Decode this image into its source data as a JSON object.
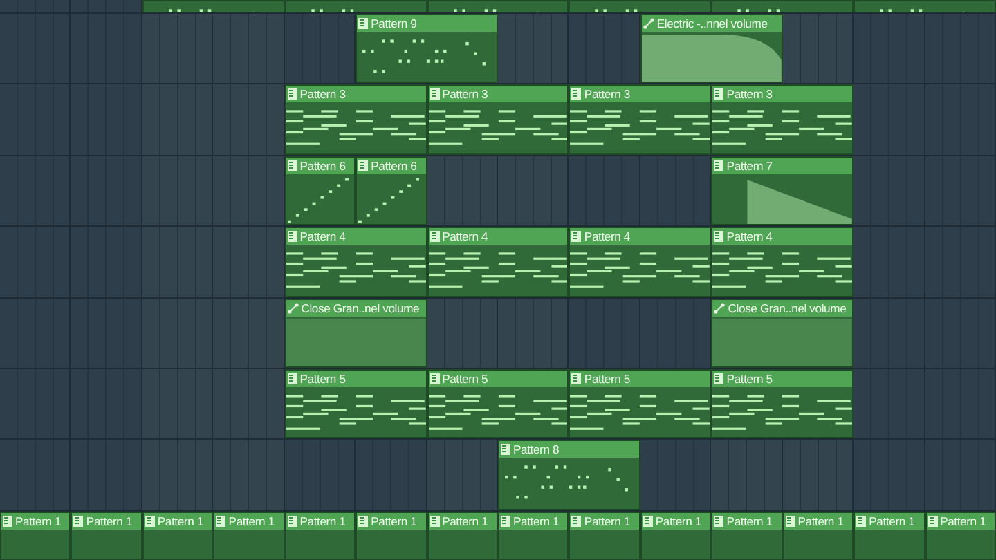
{
  "playlist": {
    "tracks": [
      {
        "items": [
          {
            "kind": "gap"
          },
          {
            "kind": "gap"
          },
          {
            "kind": "drums"
          },
          {
            "kind": "drums"
          },
          {
            "kind": "drums"
          },
          {
            "kind": "drums"
          },
          {
            "kind": "drums"
          },
          {
            "kind": "drums"
          }
        ]
      },
      {
        "items": [
          {
            "kind": "gap"
          },
          {
            "kind": "gap"
          },
          {
            "kind": "gap"
          },
          {
            "kind": "gap"
          },
          {
            "kind": "gap"
          },
          {
            "kind": "drums",
            "label": "Pattern 9"
          },
          {
            "kind": "gap"
          },
          {
            "kind": "gap"
          },
          {
            "kind": "automation-fall",
            "label": "Electric -..nnel volume"
          }
        ]
      },
      {
        "items": [
          {
            "kind": "gap"
          },
          {
            "kind": "gap"
          },
          {
            "kind": "gap"
          },
          {
            "kind": "gap"
          },
          {
            "kind": "notes",
            "label": "Pattern 3"
          },
          {
            "kind": "notes",
            "label": "Pattern 3"
          },
          {
            "kind": "notes",
            "label": "Pattern 3"
          },
          {
            "kind": "notes",
            "label": "Pattern 3"
          }
        ]
      },
      {
        "items": [
          {
            "kind": "gap"
          },
          {
            "kind": "gap"
          },
          {
            "kind": "gap"
          },
          {
            "kind": "gap"
          },
          {
            "kind": "ramp",
            "label": "Pattern 6"
          },
          {
            "kind": "ramp",
            "label": "Pattern 6"
          },
          {
            "kind": "gap"
          },
          {
            "kind": "gap"
          },
          {
            "kind": "gap"
          },
          {
            "kind": "gap"
          },
          {
            "kind": "slope",
            "label": "Pattern 7"
          }
        ]
      },
      {
        "items": [
          {
            "kind": "gap"
          },
          {
            "kind": "gap"
          },
          {
            "kind": "gap"
          },
          {
            "kind": "gap"
          },
          {
            "kind": "notes",
            "label": "Pattern 4"
          },
          {
            "kind": "notes",
            "label": "Pattern 4"
          },
          {
            "kind": "notes",
            "label": "Pattern 4"
          },
          {
            "kind": "notes",
            "label": "Pattern 4"
          }
        ]
      },
      {
        "items": [
          {
            "kind": "gap"
          },
          {
            "kind": "gap"
          },
          {
            "kind": "gap"
          },
          {
            "kind": "gap"
          },
          {
            "kind": "automation-flat",
            "label": "Close Gran..nel volume"
          },
          {
            "kind": "gap"
          },
          {
            "kind": "gap"
          },
          {
            "kind": "gap"
          },
          {
            "kind": "gap"
          },
          {
            "kind": "automation-flat",
            "label": "Close Gran..nel volume"
          }
        ]
      },
      {
        "items": [
          {
            "kind": "gap"
          },
          {
            "kind": "gap"
          },
          {
            "kind": "gap"
          },
          {
            "kind": "gap"
          },
          {
            "kind": "notes",
            "label": "Pattern 5"
          },
          {
            "kind": "notes",
            "label": "Pattern 5"
          },
          {
            "kind": "notes",
            "label": "Pattern 5"
          },
          {
            "kind": "notes",
            "label": "Pattern 5"
          }
        ]
      },
      {
        "items": [
          {
            "kind": "gap"
          },
          {
            "kind": "gap"
          },
          {
            "kind": "gap"
          },
          {
            "kind": "gap"
          },
          {
            "kind": "gap"
          },
          {
            "kind": "gap"
          },
          {
            "kind": "gap"
          },
          {
            "kind": "drums",
            "label": "Pattern 8"
          }
        ]
      },
      {
        "items": [
          {
            "kind": "plain",
            "label": "Pattern 1"
          },
          {
            "kind": "plain",
            "label": "Pattern 1"
          },
          {
            "kind": "plain",
            "label": "Pattern 1"
          },
          {
            "kind": "plain",
            "label": "Pattern 1"
          },
          {
            "kind": "plain",
            "label": "Pattern 1"
          },
          {
            "kind": "plain",
            "label": "Pattern 1"
          },
          {
            "kind": "plain",
            "label": "Pattern 1"
          },
          {
            "kind": "plain",
            "label": "Pattern 1"
          },
          {
            "kind": "plain",
            "label": "Pattern 1"
          },
          {
            "kind": "plain",
            "label": "Pattern 1"
          },
          {
            "kind": "plain",
            "label": "Pattern 1"
          },
          {
            "kind": "plain",
            "label": "Pattern 1"
          },
          {
            "kind": "plain",
            "label": "Pattern 1"
          },
          {
            "kind": "plain",
            "label": "Pattern 1"
          }
        ]
      }
    ]
  }
}
